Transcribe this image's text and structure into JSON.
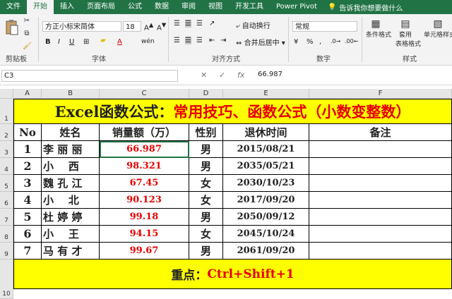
{
  "tabs": [
    "文件",
    "开始",
    "插入",
    "页面布局",
    "公式",
    "数据",
    "审阅",
    "视图",
    "开发工具",
    "Power Pivot"
  ],
  "active_tab": "开始",
  "tell_me": "告诉我你想要做什么",
  "ribbon": {
    "clipboard_label": "剪贴板",
    "font_label": "字体",
    "font_name": "方正小标宋简体",
    "font_size": "18",
    "bold": "B",
    "italic": "I",
    "underline": "U",
    "font_color_glyph": "A",
    "wen": "wén",
    "align_label": "对齐方式",
    "wrap_text": "自动换行",
    "merge_center": "合并后居中",
    "number_label": "数字",
    "number_format": "常规",
    "percent": "%",
    "comma": ",",
    "cond_format": "条件格式",
    "table_format_1": "套用",
    "table_format_2": "表格格式",
    "cell_styles": "单元格样式",
    "styles_label": "样式"
  },
  "formula_bar": {
    "name_box": "C3",
    "cancel": "✕",
    "confirm": "✓",
    "fx": "fx",
    "value": "66.987"
  },
  "columns": [
    "A",
    "B",
    "C",
    "D",
    "E",
    "F"
  ],
  "rows": [
    "1",
    "2",
    "3",
    "4",
    "5",
    "6",
    "7",
    "8",
    "9",
    "10"
  ],
  "sheet": {
    "title_black": "Excel函数公式：",
    "title_red": "常用技巧、函数公式（小数变整数）",
    "headers": [
      "No",
      "姓名",
      "销量额（万）",
      "性别",
      "退休时间",
      "备注"
    ],
    "data": [
      {
        "no": "1",
        "name": "李 丽 丽",
        "sales": "66.987",
        "gender": "男",
        "date": "2015/08/21"
      },
      {
        "no": "2",
        "name": "小    西",
        "sales": "98.321",
        "gender": "男",
        "date": "2035/05/21"
      },
      {
        "no": "3",
        "name": "魏 孔 江",
        "sales": "67.45",
        "gender": "女",
        "date": "2030/10/23"
      },
      {
        "no": "4",
        "name": "小    北",
        "sales": "90.123",
        "gender": "女",
        "date": "2017/09/20"
      },
      {
        "no": "5",
        "name": "杜 婷 婷",
        "sales": "99.18",
        "gender": "男",
        "date": "2050/09/12"
      },
      {
        "no": "6",
        "name": "小    王",
        "sales": "94.15",
        "gender": "女",
        "date": "2045/10/24"
      },
      {
        "no": "7",
        "name": "马 有 才",
        "sales": "99.67",
        "gender": "男",
        "date": "2061/09/20"
      }
    ],
    "footer_black": "重点：",
    "footer_red": "Ctrl+Shift+1"
  }
}
